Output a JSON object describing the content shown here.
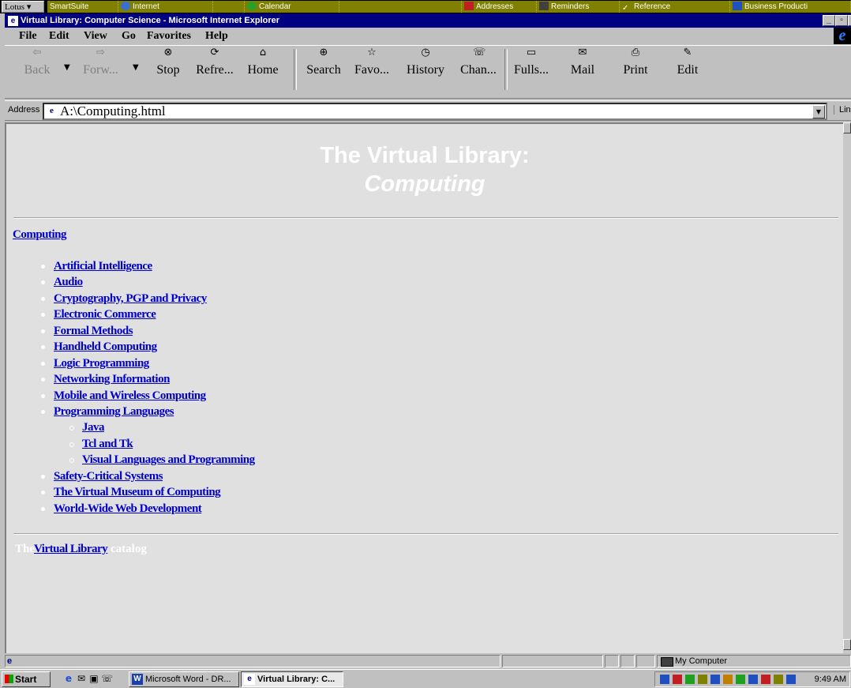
{
  "lotus": {
    "menu_label": "Lotus",
    "drawers": [
      "SmartSuite",
      "Internet",
      "Calendar",
      "Addresses",
      "Reminders",
      "Reference",
      "Business Producti"
    ]
  },
  "window": {
    "title": "Virtual Library: Computer Science - Microsoft Internet Explorer"
  },
  "menubar": {
    "items": [
      "File",
      "Edit",
      "View",
      "Go",
      "Favorites",
      "Help"
    ]
  },
  "toolbar": {
    "buttons": [
      {
        "label": "Back",
        "icon": "back-arrow-icon"
      },
      {
        "label": "Forw...",
        "icon": "forward-arrow-icon"
      },
      {
        "label": "Stop",
        "icon": "stop-icon"
      },
      {
        "label": "Refre...",
        "icon": "refresh-icon"
      },
      {
        "label": "Home",
        "icon": "home-icon"
      },
      {
        "label": "Search",
        "icon": "search-icon"
      },
      {
        "label": "Favo...",
        "icon": "favorites-icon"
      },
      {
        "label": "History",
        "icon": "history-icon"
      },
      {
        "label": "Chan...",
        "icon": "channels-icon"
      },
      {
        "label": "Fulls...",
        "icon": "fullscreen-icon"
      },
      {
        "label": "Mail",
        "icon": "mail-icon"
      },
      {
        "label": "Print",
        "icon": "print-icon"
      },
      {
        "label": "Edit",
        "icon": "edit-icon"
      }
    ]
  },
  "address": {
    "label": "Address",
    "value": "A:\\Computing.html",
    "links_label": "Links"
  },
  "page": {
    "heading_line1": "The Virtual Library:",
    "heading_line2": "Computing",
    "section_link": "Computing",
    "items": [
      "Artificial Intelligence",
      "Audio",
      "Cryptography, PGP and Privacy",
      "Electronic Commerce",
      "Formal Methods",
      "Handheld Computing",
      "Logic Programming",
      "Networking Information",
      "Mobile and Wireless Computing",
      "Programming Languages"
    ],
    "subitems": [
      "Java",
      "Tcl and Tk",
      "Visual Languages and Programming"
    ],
    "items_after": [
      "Safety-Critical Systems",
      "The Virtual Museum of Computing",
      "World-Wide Web Development"
    ],
    "footer_prefix": "The",
    "footer_link": "Virtual Library",
    "footer_suffix": "catalog"
  },
  "status": {
    "zone": "My Computer"
  },
  "taskbar": {
    "start_label": "Start",
    "tasks": [
      "Microsoft Word - DR...",
      "Virtual Library: C..."
    ],
    "clock": "9:49 AM"
  },
  "colors": {
    "link": "#0000c8",
    "titlebar": "#000080",
    "lotus_drawer": "#7f7f00",
    "content_bg": "#e0e0e0"
  }
}
